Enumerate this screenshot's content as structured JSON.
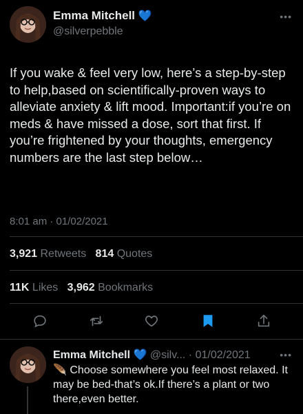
{
  "tweet": {
    "author_name": "Emma Mitchell",
    "author_handle": "@silverpebble",
    "verified_emoji": "💙",
    "more_icon": "more-icon",
    "text": "If you wake & feel very low, here’s a step-by-step to help,based on scientifically-proven ways to alleviate anxiety & lift mood. Important:if you’re on meds & have missed a dose, sort that first. If you’re frightened by your thoughts, emergency numbers are the last step below…",
    "timestamp": "8:01 am · 01/02/2021",
    "retweets_count": "3,921",
    "retweets_label": "Retweets",
    "quotes_count": "814",
    "quotes_label": "Quotes",
    "likes_count": "11K",
    "likes_label": "Likes",
    "bookmarks_count": "3,962",
    "bookmarks_label": "Bookmarks"
  },
  "actions": [
    {
      "name": "reply",
      "icon": "reply-icon"
    },
    {
      "name": "retweet",
      "icon": "retweet-icon"
    },
    {
      "name": "like",
      "icon": "heart-icon"
    },
    {
      "name": "bookmark",
      "icon": "bookmark-icon",
      "active": true
    },
    {
      "name": "share",
      "icon": "share-icon"
    }
  ],
  "reply": {
    "author_name": "Emma Mitchell",
    "verified_emoji": "💙",
    "author_handle": "@silv...",
    "separator": " · ",
    "date": "01/02/2021",
    "emoji": "🪶",
    "text": "Choose somewhere you feel most relaxed. It may be bed-that’s ok.If there’s a plant or two there,even better."
  },
  "colors": {
    "background": "#000000",
    "text": "#e7e9ea",
    "secondary": "#71767b",
    "accent": "#1d9bf0",
    "divider": "#2f3336"
  }
}
